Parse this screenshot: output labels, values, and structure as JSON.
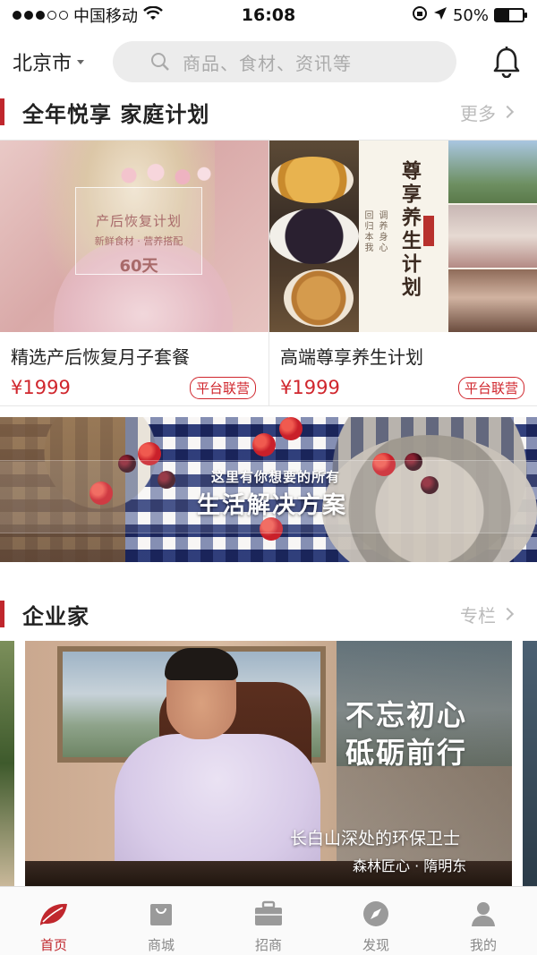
{
  "status_bar": {
    "carrier": "中国移动",
    "time": "16:08",
    "battery": "50%",
    "battery_level": 0.5,
    "signal_bars_filled": 3,
    "signal_bars_total": 5
  },
  "header": {
    "city": "北京市",
    "search_placeholder": "商品、食材、资讯等"
  },
  "section_family": {
    "title": "全年悦享 家庭计划",
    "more_label": "更多"
  },
  "products": [
    {
      "name": "精选产后恢复月子套餐",
      "price": "¥1999",
      "tag": "平台联营",
      "image_text": {
        "title": "产后恢复计划",
        "subtitle": "新鲜食材 · 营养搭配",
        "days": "60天"
      }
    },
    {
      "name": "高端尊享养生计划",
      "price": "¥1999",
      "tag": "平台联营",
      "image_text": {
        "title": "尊享养生计划",
        "line1": "调养身心",
        "line2": "回归本我"
      }
    }
  ],
  "banner": {
    "line1": "这里有你想要的所有",
    "line2": "生活解决方案"
  },
  "section_entrepreneur": {
    "title": "企业家",
    "more_label": "专栏",
    "card": {
      "headline1": "不忘初心",
      "headline2": "砥砺前行",
      "subtitle": "长白山深处的环保卫士",
      "signature": "森林匠心 · 隋明东"
    }
  },
  "tabbar": {
    "items": [
      {
        "label": "首页",
        "icon": "home-leaf-icon",
        "active": true
      },
      {
        "label": "商城",
        "icon": "shopping-bag-icon",
        "active": false
      },
      {
        "label": "招商",
        "icon": "briefcase-icon",
        "active": false
      },
      {
        "label": "发现",
        "icon": "compass-icon",
        "active": false
      },
      {
        "label": "我的",
        "icon": "user-icon",
        "active": false
      }
    ]
  },
  "colors": {
    "accent": "#c0272d",
    "price": "#d0262d",
    "muted": "#bbbbbb",
    "search_bg": "#ececec"
  }
}
